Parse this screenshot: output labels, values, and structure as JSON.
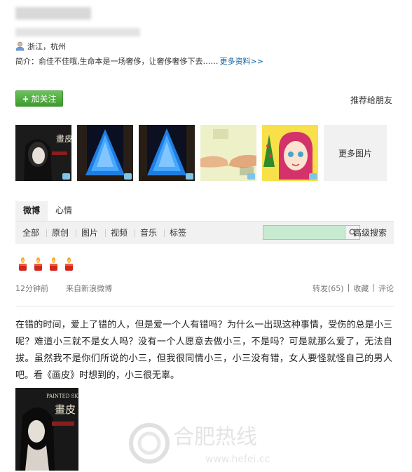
{
  "profile": {
    "location": "浙江，杭州",
    "intro_label": "简介：",
    "intro_text": "俞佳不佳哦,生命本是一场奢侈，让奢侈奢侈下去……",
    "more_info": "更多资料>>"
  },
  "actions": {
    "follow_label": "加关注",
    "recommend_label": "推荐给朋友"
  },
  "gallery": {
    "more_label": "更多图片"
  },
  "tabs": [
    {
      "label": "微博"
    },
    {
      "label": "心情"
    }
  ],
  "filters": [
    "全部",
    "原创",
    "图片",
    "视频",
    "音乐",
    "标签"
  ],
  "search": {
    "advanced_label": "高级搜索"
  },
  "post": {
    "time": "12分钟前",
    "source": "来自新浪微博",
    "repost": "转发(65)",
    "sep1": "|",
    "favorite": "收藏",
    "sep2": "|",
    "comment": "评论",
    "content": "在错的时间，爱上了错的人，但是爱一个人有错吗？为什么一出现这种事情，受伤的总是小三呢？难道小三就不是女人吗？没有一个人愿意去做小三，不是吗？可是就那么爱了，无法自拔。虽然我不是你们所说的小三，但我很同情小三，小三没有错，女人要怪就怪自己的男人吧。看《画皮》时想到的，小三很无辜。",
    "image_title": "PAINTED SKIN",
    "image_char": "畫皮"
  },
  "watermark": {
    "text": "合肥热线",
    "url": "www.hefei.cc"
  },
  "thumb_titles": [
    "畫皮",
    "",
    "",
    "",
    ""
  ],
  "colors": {
    "follow_green": "#4caf3c",
    "link_blue": "#0a5c9c",
    "search_field": "#c7ebd1",
    "bar_gray": "#f1f1f1"
  }
}
